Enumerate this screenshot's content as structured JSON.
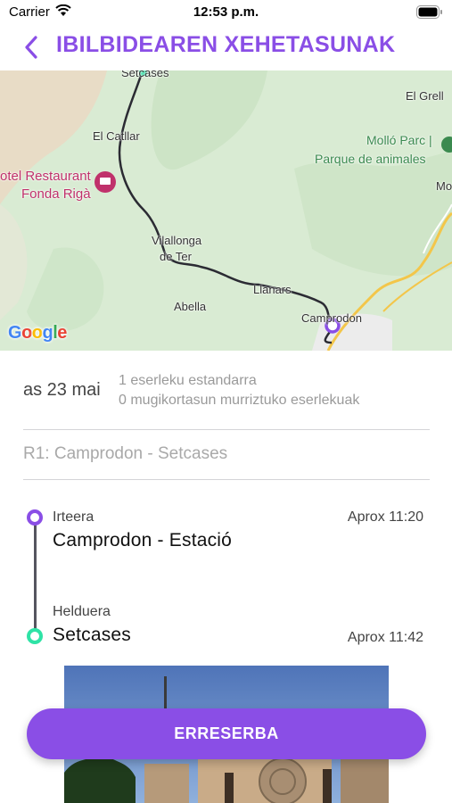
{
  "status_bar": {
    "carrier": "Carrier",
    "time": "12:53 p.m."
  },
  "header": {
    "title": "IBILBIDEAREN XEHETASUNAK",
    "back_icon": "chevron-left-icon"
  },
  "map": {
    "labels": {
      "setcases": "Setcases",
      "el_grell": "El Grell",
      "el_catllar": "El Catllar",
      "mollo_parc": "Molló Parc |",
      "parque": "Parque de animales",
      "mo": "Mo",
      "hotel_1": "otel Restaurant",
      "hotel_2": "Fonda Rigà",
      "vilallonga_1": "Vilallonga",
      "vilallonga_2": "de Ter",
      "llanars": "Llanars",
      "abella": "Abella",
      "camprodon": "Camprodon"
    },
    "attribution": "Google"
  },
  "trip": {
    "date": "as 23 mai",
    "seats_standard": "1 eserleku estandarra",
    "seats_reduced": "0 mugikortasun murriztuko eserlekuak",
    "route": "R1: Camprodon - Setcases"
  },
  "departure": {
    "label": "Irteera",
    "name": "Camprodon - Estació",
    "time": "Aprox 11:20"
  },
  "arrival": {
    "label": "Helduera",
    "name": "Setcases",
    "time": "Aprox 11:42"
  },
  "cta": {
    "label": "ERRESERBA"
  },
  "colors": {
    "accent": "#8a4ee6",
    "arrival": "#2fe3a6"
  }
}
